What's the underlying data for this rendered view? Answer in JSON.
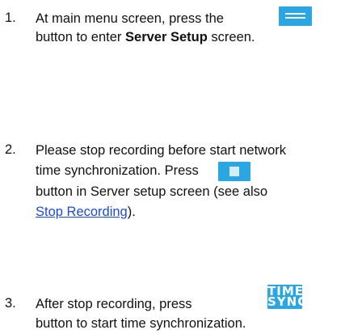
{
  "steps": [
    {
      "number": "1.",
      "line1_before": "At main menu screen, press the",
      "line2_before": "button to enter",
      "line2_bold": "Server Setup",
      "line2_after": "screen.",
      "button_icon": "server-setup-icon"
    },
    {
      "number": "2.",
      "line1": "Please stop recording before start network",
      "line2": "time synchronization. Press",
      "line3": "button in Server setup screen (see also",
      "link_text": "Stop Recording",
      "after_link": ").",
      "button_icon": "stop-icon"
    },
    {
      "number": "3.",
      "line1": "After stop recording, press",
      "line2": "button to start time synchronization.",
      "button_text_top": "TIME",
      "button_text_bottom": "SYNC"
    }
  ],
  "colors": {
    "button_blue": "#2aa7e2",
    "link": "#1d4bd8"
  }
}
